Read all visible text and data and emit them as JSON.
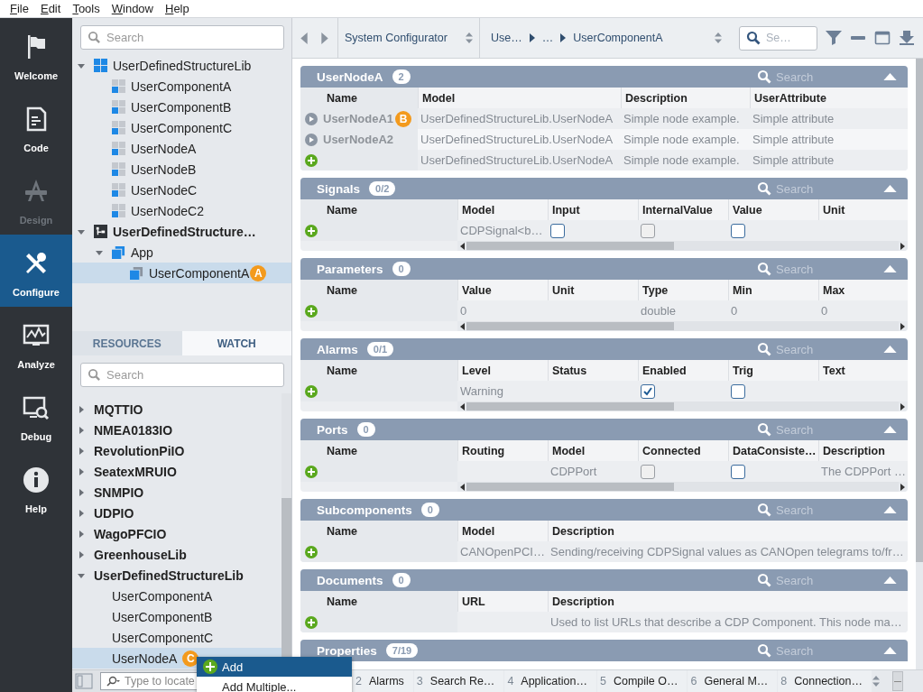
{
  "menu": [
    "File",
    "Edit",
    "Tools",
    "Window",
    "Help"
  ],
  "sidebar": [
    {
      "label": "Welcome",
      "selected": false,
      "disabled": false
    },
    {
      "label": "Code",
      "selected": false,
      "disabled": false
    },
    {
      "label": "Design",
      "selected": false,
      "disabled": true
    },
    {
      "label": "Configure",
      "selected": true,
      "disabled": false
    },
    {
      "label": "Analyze",
      "selected": false,
      "disabled": false
    },
    {
      "label": "Debug",
      "selected": false,
      "disabled": false
    },
    {
      "label": "Help",
      "selected": false,
      "disabled": false
    }
  ],
  "explorer": {
    "search": {
      "placeholder": "Search"
    },
    "tree": [
      {
        "label": "UserDefinedStructureLib",
        "kind": "library",
        "expanded": true,
        "selected": false,
        "children": [
          {
            "label": "UserComponentA",
            "kind": "component",
            "selected": false
          },
          {
            "label": "UserComponentB",
            "kind": "component",
            "selected": false
          },
          {
            "label": "UserComponentC",
            "kind": "component",
            "selected": false
          },
          {
            "label": "UserNodeA",
            "kind": "component",
            "selected": false
          },
          {
            "label": "UserNodeB",
            "kind": "component",
            "selected": false
          },
          {
            "label": "UserNodeC",
            "kind": "component",
            "selected": false
          },
          {
            "label": "UserNodeC2",
            "kind": "component",
            "selected": false
          }
        ]
      },
      {
        "label": "UserDefinedStructure…",
        "kind": "system",
        "expanded": true,
        "selected": false,
        "children": [
          {
            "label": "App",
            "kind": "application",
            "expanded": true,
            "selected": false,
            "children": [
              {
                "label": "UserComponentA",
                "kind": "instance",
                "selected": true,
                "badge": "A"
              }
            ]
          }
        ]
      }
    ]
  },
  "resources": {
    "tabs": [
      {
        "label": "RESOURCES",
        "selected": true
      },
      {
        "label": "WATCH",
        "selected": false
      }
    ],
    "search": {
      "placeholder": "Search"
    },
    "items": [
      {
        "label": "MQTTIO",
        "expanded": false,
        "selected": false
      },
      {
        "label": "NMEA0183IO",
        "expanded": false,
        "selected": false
      },
      {
        "label": "RevolutionPiIO",
        "expanded": false,
        "selected": false
      },
      {
        "label": "SeatexMRUIO",
        "expanded": false,
        "selected": false
      },
      {
        "label": "SNMPIO",
        "expanded": false,
        "selected": false
      },
      {
        "label": "UDPIO",
        "expanded": false,
        "selected": false
      },
      {
        "label": "WagoPFCIO",
        "expanded": false,
        "selected": false
      },
      {
        "label": "GreenhouseLib",
        "expanded": false,
        "selected": false
      },
      {
        "label": "UserDefinedStructureLib",
        "expanded": true,
        "selected": false,
        "children": [
          {
            "label": "UserComponentA",
            "selected": false
          },
          {
            "label": "UserComponentB",
            "selected": false
          },
          {
            "label": "UserComponentC",
            "selected": false
          },
          {
            "label": "UserNodeA",
            "selected": true,
            "badge": "C"
          }
        ]
      }
    ]
  },
  "locate": {
    "placeholder": "Type to locate"
  },
  "toolbar": {
    "view": "System Configurator",
    "breadcrumb": [
      "Use…",
      "…",
      "UserComponentA"
    ],
    "search": {
      "placeholder": "Se…"
    }
  },
  "sections": [
    {
      "title": "UserNodeA",
      "count": "2",
      "kind": "nodes",
      "search_placeholder": "Search",
      "scrollable": false,
      "columns": [
        "Name",
        "Model",
        "Description",
        "UserAttribute"
      ],
      "rows": [
        {
          "kind": "node",
          "badge": "B",
          "cells": [
            {
              "kind": "name",
              "text": "UserNodeA1"
            },
            {
              "kind": "text",
              "text": "UserDefinedStructureLib.UserNodeA"
            },
            {
              "kind": "text",
              "text": "Simple node example."
            },
            {
              "kind": "text",
              "text": "Simple attribute"
            }
          ]
        },
        {
          "kind": "node",
          "cells": [
            {
              "kind": "name",
              "text": "UserNodeA2"
            },
            {
              "kind": "text",
              "text": "UserDefinedStructureLib.UserNodeA"
            },
            {
              "kind": "text",
              "text": "Simple node example."
            },
            {
              "kind": "text",
              "text": "Simple attribute"
            }
          ]
        },
        {
          "kind": "new",
          "cells": [
            {
              "kind": "empty"
            },
            {
              "kind": "text",
              "text": "UserDefinedStructureLib.UserNodeA"
            },
            {
              "kind": "text",
              "text": "Simple node example."
            },
            {
              "kind": "text",
              "text": "Simple attribute"
            }
          ]
        }
      ]
    },
    {
      "title": "Signals",
      "count": "0/2",
      "kind": "table",
      "search_placeholder": "Search",
      "scrollable": true,
      "columns": [
        "Name",
        "Model",
        "Input",
        "InternalValue",
        "Value",
        "Unit"
      ],
      "rows": [
        {
          "kind": "new",
          "cells": [
            {
              "kind": "empty"
            },
            {
              "kind": "text",
              "text": "CDPSignal<b…"
            },
            {
              "kind": "checkbox",
              "checked": false,
              "disabled": false
            },
            {
              "kind": "checkbox",
              "checked": false,
              "disabled": true
            },
            {
              "kind": "checkbox",
              "checked": false,
              "disabled": false
            },
            {
              "kind": "empty"
            }
          ]
        }
      ]
    },
    {
      "title": "Parameters",
      "count": "0",
      "kind": "table",
      "search_placeholder": "Search",
      "scrollable": true,
      "columns": [
        "Name",
        "Value",
        "Unit",
        "Type",
        "Min",
        "Max"
      ],
      "rows": [
        {
          "kind": "new",
          "cells": [
            {
              "kind": "empty"
            },
            {
              "kind": "text",
              "text": "0"
            },
            {
              "kind": "empty"
            },
            {
              "kind": "text",
              "text": "double"
            },
            {
              "kind": "text",
              "text": "0"
            },
            {
              "kind": "text",
              "text": "0"
            }
          ]
        }
      ]
    },
    {
      "title": "Alarms",
      "count": "0/1",
      "kind": "table",
      "search_placeholder": "Search",
      "scrollable": true,
      "columns": [
        "Name",
        "Level",
        "Status",
        "Enabled",
        "Trig",
        "Text"
      ],
      "rows": [
        {
          "kind": "new",
          "cells": [
            {
              "kind": "empty"
            },
            {
              "kind": "text",
              "text": "Warning"
            },
            {
              "kind": "empty"
            },
            {
              "kind": "checkbox",
              "checked": true,
              "disabled": false
            },
            {
              "kind": "checkbox",
              "checked": false,
              "disabled": false
            },
            {
              "kind": "empty"
            }
          ]
        }
      ]
    },
    {
      "title": "Ports",
      "count": "0",
      "kind": "table",
      "search_placeholder": "Search",
      "scrollable": true,
      "columns": [
        "Name",
        "Routing",
        "Model",
        "Connected",
        "DataConsiste…",
        "Description"
      ],
      "rows": [
        {
          "kind": "new",
          "cells": [
            {
              "kind": "empty"
            },
            {
              "kind": "empty"
            },
            {
              "kind": "text",
              "text": "CDPPort"
            },
            {
              "kind": "checkbox",
              "checked": false,
              "disabled": true
            },
            {
              "kind": "checkbox",
              "checked": false,
              "disabled": false
            },
            {
              "kind": "text",
              "text": "The CDPPort …"
            }
          ]
        }
      ]
    },
    {
      "title": "Subcomponents",
      "count": "0",
      "kind": "table",
      "search_placeholder": "Search",
      "scrollable": false,
      "columns": [
        "Name",
        "Model",
        "Description"
      ],
      "rows": [
        {
          "kind": "new",
          "cells": [
            {
              "kind": "empty"
            },
            {
              "kind": "text",
              "text": "CANOpenPCI…"
            },
            {
              "kind": "text",
              "text": "Sending/receiving CDPSignal values as CANOpen telegrams to/fr…"
            }
          ]
        }
      ]
    },
    {
      "title": "Documents",
      "count": "0",
      "kind": "table",
      "search_placeholder": "Search",
      "scrollable": false,
      "columns": [
        "Name",
        "URL",
        "Description"
      ],
      "rows": [
        {
          "kind": "new",
          "cells": [
            {
              "kind": "empty"
            },
            {
              "kind": "empty"
            },
            {
              "kind": "text",
              "text": "Used to list URLs that describe a CDP Component. This node ma…"
            }
          ]
        }
      ]
    },
    {
      "title": "Properties",
      "count": "7/19",
      "search_placeholder": "Search"
    }
  ],
  "context_menu": [
    {
      "label": "Add",
      "selected": true
    },
    {
      "label": "Add Multiple...",
      "selected": false
    }
  ],
  "bottom_tabs": [
    {
      "number": "2",
      "label": "Alarms"
    },
    {
      "number": "3",
      "label": "Search Re…"
    },
    {
      "number": "4",
      "label": "Application…"
    },
    {
      "number": "5",
      "label": "Compile O…"
    },
    {
      "number": "6",
      "label": "General M…"
    },
    {
      "number": "8",
      "label": "Connection…"
    }
  ]
}
